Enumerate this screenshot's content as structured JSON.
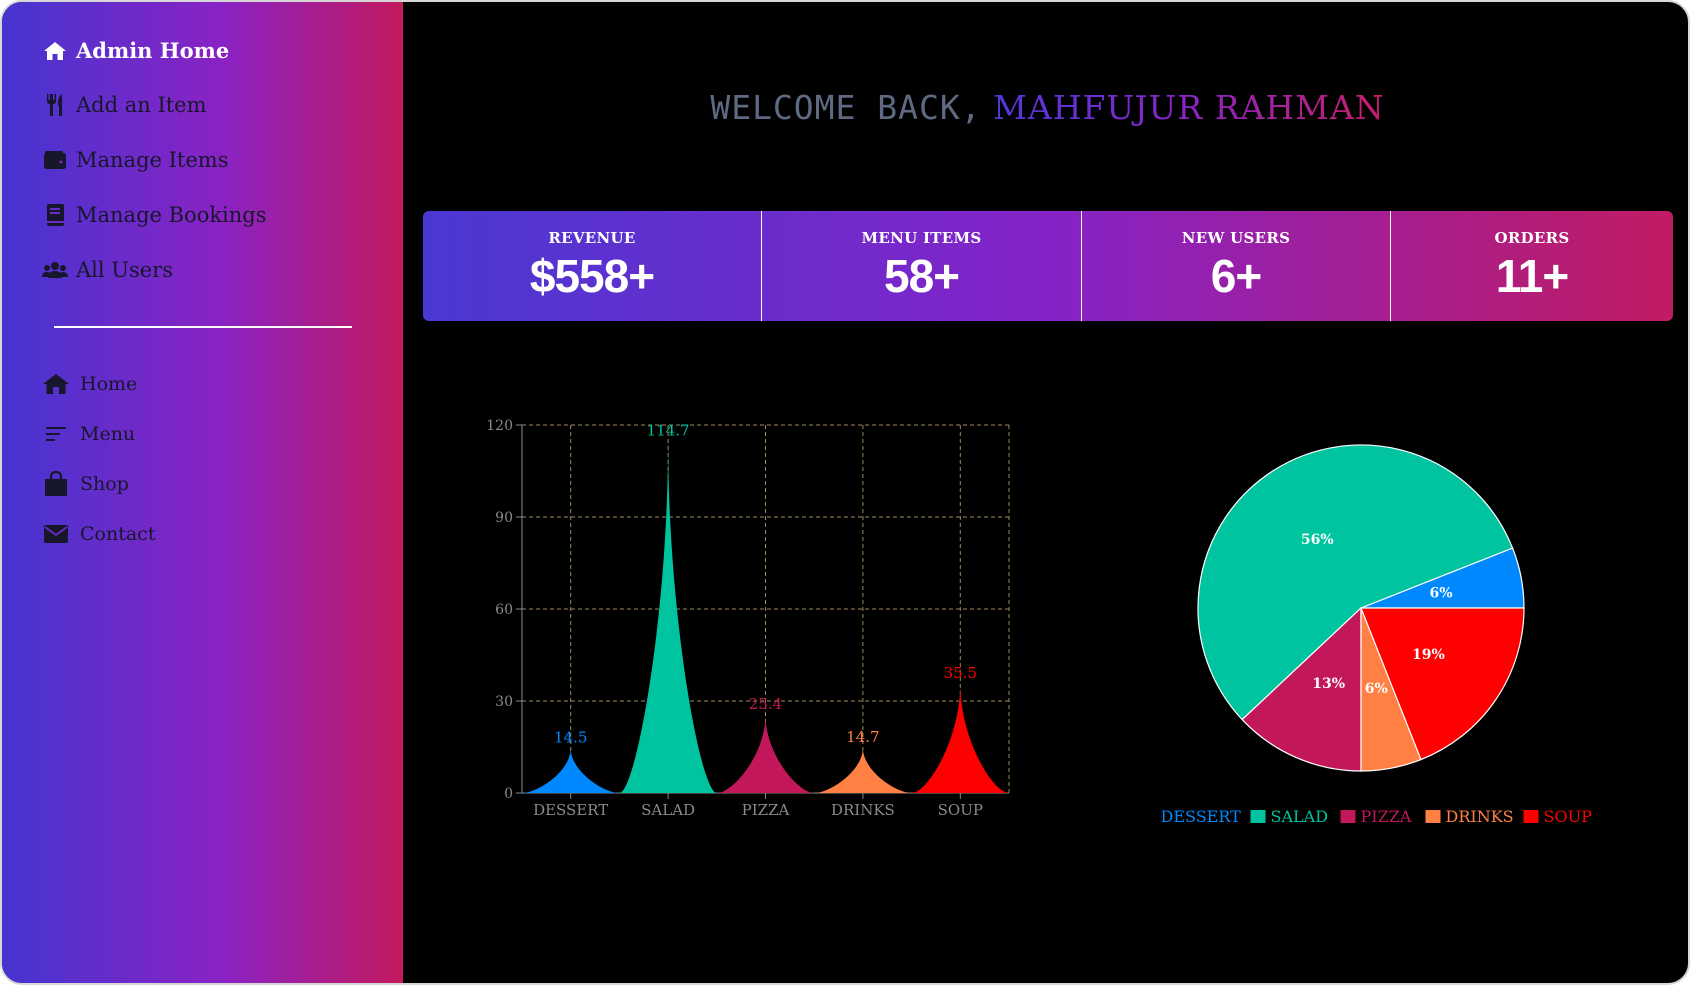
{
  "sidebar": {
    "admin_items": [
      {
        "label": "Admin Home",
        "icon": "home-icon"
      },
      {
        "label": "Add an Item",
        "icon": "utensils-icon"
      },
      {
        "label": "Manage Items",
        "icon": "wallet-icon"
      },
      {
        "label": "Manage Bookings",
        "icon": "book-icon"
      },
      {
        "label": "All Users",
        "icon": "users-icon"
      }
    ],
    "site_items": [
      {
        "label": "Home",
        "icon": "home-icon"
      },
      {
        "label": "Menu",
        "icon": "menu-lines-icon"
      },
      {
        "label": "Shop",
        "icon": "shopping-bag-icon"
      },
      {
        "label": "Contact",
        "icon": "envelope-icon"
      }
    ]
  },
  "header": {
    "greeting": "WELCOME BACK,",
    "user_name": "MAHFUJUR RAHMAN"
  },
  "stats": [
    {
      "label": "REVENUE",
      "value": "$558+"
    },
    {
      "label": "MENU ITEMS",
      "value": "58+"
    },
    {
      "label": "NEW USERS",
      "value": "6+"
    },
    {
      "label": "ORDERS",
      "value": "11+"
    }
  ],
  "colors": {
    "dessert": "#0088FE",
    "salad": "#00C49F",
    "pizza": "#C2185B",
    "drinks": "#FF8042",
    "soup": "#FF0000"
  },
  "chart_data": [
    {
      "type": "bar",
      "shape": "triangle-peak",
      "categories": [
        "DESSERT",
        "SALAD",
        "PIZZA",
        "DRINKS",
        "SOUP"
      ],
      "values": [
        14.5,
        114.7,
        25.4,
        14.7,
        35.5
      ],
      "value_labels": [
        "14.5",
        "114.7",
        "25.4",
        "14.7",
        "35.5"
      ],
      "y_ticks": [
        "0",
        "30",
        "60",
        "90",
        "120"
      ],
      "ylim": [
        0,
        120
      ],
      "grid": true
    },
    {
      "type": "pie",
      "labels": [
        "DESSERT",
        "SALAD",
        "PIZZA",
        "DRINKS",
        "SOUP"
      ],
      "values": [
        6,
        56,
        13,
        6,
        19
      ],
      "slice_labels": [
        "6%",
        "56%",
        "13%",
        "6%",
        "19%"
      ],
      "legend": "bottom"
    }
  ]
}
